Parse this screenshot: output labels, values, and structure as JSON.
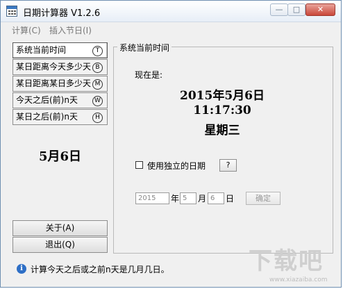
{
  "window": {
    "title": "日期计算器  V1.2.6"
  },
  "menu": [
    "计算(C)",
    "插入节日(I)"
  ],
  "nav": [
    {
      "label": "系统当前时间",
      "key": "T"
    },
    {
      "label": "某日距离今天多少天",
      "key": "B"
    },
    {
      "label": "某日距离某日多少天",
      "key": "M"
    },
    {
      "label": "今天之后(前)n天",
      "key": "W"
    },
    {
      "label": "某日之后(前)n天",
      "key": "H"
    }
  ],
  "today_short": "5月6日",
  "footer_buttons": {
    "about": "关于(A)",
    "exit": "退出(Q)"
  },
  "panel": {
    "group_title": "系统当前时间",
    "now_label": "现在是:",
    "date": "2015年5月6日",
    "time": "11:17:30",
    "weekday": "星期三",
    "use_independent_date": "使用独立的日期",
    "help_label": "?",
    "year_value": "2015",
    "year_unit": "年",
    "month_value": "5",
    "month_unit": "月",
    "day_value": "6",
    "day_unit": "日",
    "confirm": "确定"
  },
  "status": "计算今天之后或之前n天是几月几日。",
  "watermark": {
    "brand": "下载吧",
    "site": "www.xiazaiba.com"
  },
  "colors": {
    "accent": "#2e6fc6",
    "close": "#c9473a"
  }
}
